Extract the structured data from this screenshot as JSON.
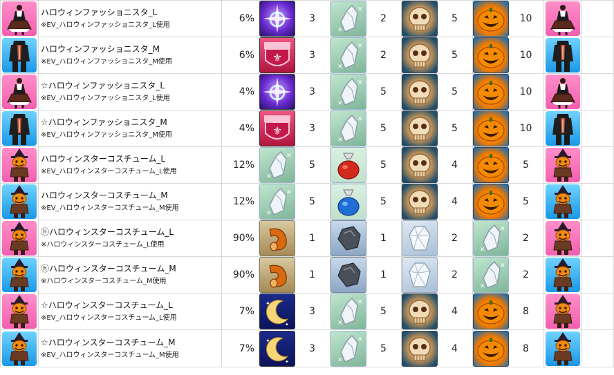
{
  "rows": [
    {
      "name": "ハロウィンファッショニスタ_L",
      "note": "※EV_ハロウィンファッショニスタ_L使用",
      "rate": "6%",
      "costume": "pink-dress-costume",
      "bg": "pink",
      "materials": [
        {
          "icon": "purple-sparkle-icon",
          "qty": "3"
        },
        {
          "icon": "crystal-shard-icon",
          "qty": "2"
        },
        {
          "icon": "skull-icon",
          "qty": "5"
        },
        {
          "icon": "jack-o-lantern-icon",
          "qty": "10"
        }
      ]
    },
    {
      "name": "ハロウィンファッショニスタ_M",
      "note": "※EV_ハロウィンファッショニスタ_M使用",
      "rate": "6%",
      "costume": "black-suit-costume",
      "bg": "blue",
      "materials": [
        {
          "icon": "fleur-de-lis-crest-icon",
          "qty": "3"
        },
        {
          "icon": "crystal-shard-icon",
          "qty": "2"
        },
        {
          "icon": "skull-icon",
          "qty": "5"
        },
        {
          "icon": "jack-o-lantern-icon",
          "qty": "10"
        }
      ]
    },
    {
      "name": "☆ハロウィンファッショニスタ_L",
      "note": "※EV_ハロウィンファッショニスタ_L使用",
      "rate": "4%",
      "costume": "pink-dress-costume",
      "bg": "pink",
      "materials": [
        {
          "icon": "purple-sparkle-icon",
          "qty": "3"
        },
        {
          "icon": "crystal-shard-icon",
          "qty": "5"
        },
        {
          "icon": "skull-icon",
          "qty": "5"
        },
        {
          "icon": "jack-o-lantern-icon",
          "qty": "10"
        }
      ]
    },
    {
      "name": "☆ハロウィンファッショニスタ_M",
      "note": "※EV_ハロウィンファッショニスタ_M使用",
      "rate": "4%",
      "costume": "black-suit-costume",
      "bg": "blue",
      "materials": [
        {
          "icon": "fleur-de-lis-crest-icon",
          "qty": "3"
        },
        {
          "icon": "crystal-shard-icon",
          "qty": "5"
        },
        {
          "icon": "skull-icon",
          "qty": "5"
        },
        {
          "icon": "jack-o-lantern-icon",
          "qty": "10"
        }
      ]
    },
    {
      "name": "ハロウィンスターコスチューム_L",
      "note": "※EV_ハロウィンスターコスチューム_L使用",
      "rate": "12%",
      "costume": "pumpkin-scarecrow-costume",
      "bg": "pink",
      "materials": [
        {
          "icon": "crystal-shard-icon",
          "qty": "5"
        },
        {
          "icon": "red-pouch-icon",
          "qty": "5"
        },
        {
          "icon": "skull-icon",
          "qty": "4"
        },
        {
          "icon": "jack-o-lantern-icon",
          "qty": "5"
        }
      ]
    },
    {
      "name": "ハロウィンスターコスチューム_M",
      "note": "※EV_ハロウィンスターコスチューム_M使用",
      "rate": "12%",
      "costume": "pumpkin-scarecrow-costume",
      "bg": "blue",
      "materials": [
        {
          "icon": "crystal-shard-icon",
          "qty": "5"
        },
        {
          "icon": "blue-pouch-icon",
          "qty": "5"
        },
        {
          "icon": "skull-icon",
          "qty": "4"
        },
        {
          "icon": "jack-o-lantern-icon",
          "qty": "5"
        }
      ]
    },
    {
      "name": "ⓗハロウィンスターコスチューム_L",
      "note": "※ハロウィンスターコスチューム_L使用",
      "rate": "90%",
      "costume": "pumpkin-scarecrow-costume",
      "bg": "pink",
      "materials": [
        {
          "icon": "copper-pipe-icon",
          "qty": "1"
        },
        {
          "icon": "gray-stone-icon",
          "qty": "1"
        },
        {
          "icon": "clear-crystal-icon",
          "qty": "2"
        },
        {
          "icon": "crystal-shard-icon",
          "qty": "2"
        }
      ]
    },
    {
      "name": "ⓗハロウィンスターコスチューム_M",
      "note": "※ハロウィンスターコスチューム_M使用",
      "rate": "90%",
      "costume": "pumpkin-scarecrow-costume",
      "bg": "blue",
      "materials": [
        {
          "icon": "copper-pipe-icon",
          "qty": "1"
        },
        {
          "icon": "gray-stone-icon",
          "qty": "1"
        },
        {
          "icon": "clear-crystal-icon",
          "qty": "2"
        },
        {
          "icon": "crystal-shard-icon",
          "qty": "2"
        }
      ]
    },
    {
      "name": "☆ハロウィンスターコスチューム_L",
      "note": "※EV_ハロウィンスターコスチューム_L使用",
      "rate": "7%",
      "costume": "pumpkin-scarecrow-costume",
      "bg": "pink",
      "materials": [
        {
          "icon": "crescent-moon-icon",
          "qty": "3"
        },
        {
          "icon": "crystal-shard-icon",
          "qty": "5"
        },
        {
          "icon": "skull-icon",
          "qty": "4"
        },
        {
          "icon": "jack-o-lantern-icon",
          "qty": "8"
        }
      ]
    },
    {
      "name": "☆ハロウィンスターコスチューム_M",
      "note": "※EV_ハロウィンスターコスチューム_M使用",
      "rate": "7%",
      "costume": "pumpkin-scarecrow-costume",
      "bg": "blue",
      "materials": [
        {
          "icon": "crescent-moon-icon",
          "qty": "3"
        },
        {
          "icon": "crystal-shard-icon",
          "qty": "5"
        },
        {
          "icon": "skull-icon",
          "qty": "4"
        },
        {
          "icon": "jack-o-lantern-icon",
          "qty": "8"
        }
      ]
    }
  ]
}
